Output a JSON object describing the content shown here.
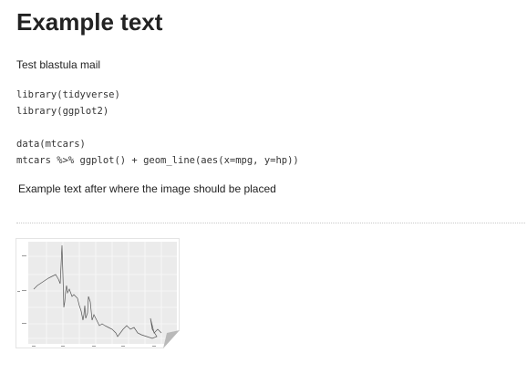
{
  "document": {
    "heading": "Example text",
    "intro": "Test blastula mail",
    "code_lines": [
      "library(tidyverse)",
      "library(ggplot2)",
      "",
      "data(mtcars)",
      "mtcars %>% ggplot() + geom_line(aes(x=mpg, y=hp))"
    ],
    "after_text": "Example text after where the image should be placed"
  },
  "image": {
    "kind": "embedded line-plot thumbnail with page-curl",
    "panel_color": "#ebebeb",
    "line_color": "#555555"
  }
}
